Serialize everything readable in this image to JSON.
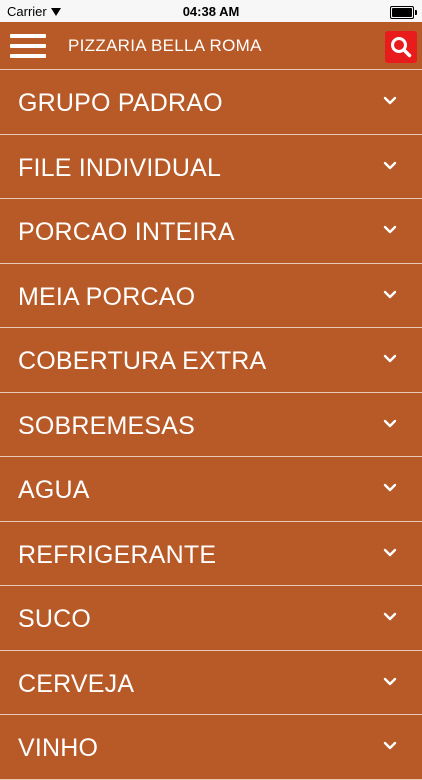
{
  "status_bar": {
    "carrier": "Carrier",
    "time": "04:38 AM"
  },
  "nav": {
    "title": "PIZZARIA BELLA ROMA",
    "menu_icon": "hamburger-menu-icon",
    "search_icon": "search-icon"
  },
  "colors": {
    "background": "#B85A28",
    "text": "#FFFFFF",
    "divider": "#E8C9B6",
    "search_button": "#E81C1C"
  },
  "categories": [
    {
      "label": "GRUPO PADRAO",
      "icon": "chevron-down-icon"
    },
    {
      "label": "FILE INDIVIDUAL",
      "icon": "chevron-down-icon"
    },
    {
      "label": "PORCAO INTEIRA",
      "icon": "chevron-down-icon"
    },
    {
      "label": "MEIA PORCAO",
      "icon": "chevron-down-icon"
    },
    {
      "label": "COBERTURA EXTRA",
      "icon": "chevron-down-icon"
    },
    {
      "label": "SOBREMESAS",
      "icon": "chevron-down-icon"
    },
    {
      "label": "AGUA",
      "icon": "chevron-down-icon"
    },
    {
      "label": "REFRIGERANTE",
      "icon": "chevron-down-icon"
    },
    {
      "label": "SUCO",
      "icon": "chevron-down-icon"
    },
    {
      "label": "CERVEJA",
      "icon": "chevron-down-icon"
    },
    {
      "label": "VINHO",
      "icon": "chevron-down-icon"
    }
  ]
}
